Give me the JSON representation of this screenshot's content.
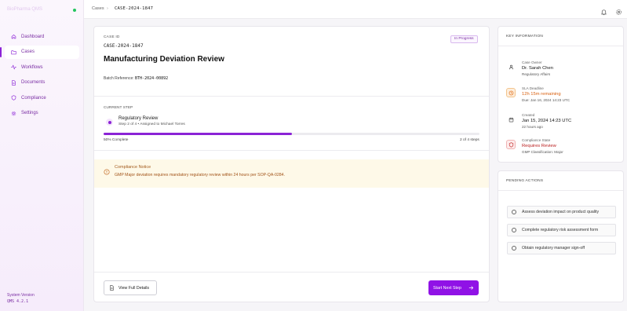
{
  "sidebar": {
    "brand": "BioPharma QMS",
    "items": [
      {
        "label": "Dashboard",
        "icon": "home-icon"
      },
      {
        "label": "Cases",
        "icon": "folder-icon"
      },
      {
        "label": "Workflows",
        "icon": "activity-icon"
      },
      {
        "label": "Documents",
        "icon": "document-icon"
      },
      {
        "label": "Compliance",
        "icon": "shield-icon"
      },
      {
        "label": "Settings",
        "icon": "gear-icon"
      }
    ],
    "system_label": "System Version",
    "system_version": "QMS 4.2.1"
  },
  "topbar": {
    "crumb_root": "Cases",
    "crumb_separator": "›",
    "crumb_current": "CASE-2024-1847"
  },
  "case": {
    "id_label": "CASE ID",
    "id": "CASE-2024-1847",
    "status": "In Progress",
    "title": "Manufacturing Deviation Review",
    "batch_label": "Batch Reference: ",
    "batch_value": "BTH-2024-00892",
    "current_step_label": "CURRENT STEP",
    "step_name": "Regulatory Review",
    "step_sub": "Step 2 of 4 • Assigned to Michael Torres",
    "progress_percent": 50,
    "progress_left": "50% Complete",
    "progress_right": "2 of 4 steps",
    "notice_title": "Compliance Notice",
    "notice_text": "GMP Major deviation requires mandatory regulatory review within 24 hours per SOP-QA-0284.",
    "view_details_label": "View Full Details",
    "next_step_label": "Start Next Step"
  },
  "key_info": {
    "title": "KEY INFORMATION",
    "owner_label": "Case Owner",
    "owner_value": "Dr. Sarah Chen",
    "owner_sub": "Regulatory Affairs",
    "sla_label": "SLA Deadline",
    "sla_value": "12h 15m remaining",
    "sla_sub": "Due: Jan 16, 2024 14:23 UTC",
    "created_label": "Created",
    "created_value": "Jan 15, 2024 14:23 UTC",
    "created_sub": "22 hours ago",
    "compliance_label": "Compliance State",
    "compliance_value": "Requires Review",
    "compliance_sub": "GMP Classification: Major"
  },
  "pending": {
    "title": "PENDING ACTIONS",
    "items": [
      "Assess deviation impact on product quality",
      "Complete regulatory risk assessment form",
      "Obtain regulatory manager sign-off"
    ]
  },
  "colors": {
    "accent": "#8b23d6",
    "warning": "#ea7a1e",
    "danger": "#b91c1c",
    "online": "#22c55e"
  }
}
